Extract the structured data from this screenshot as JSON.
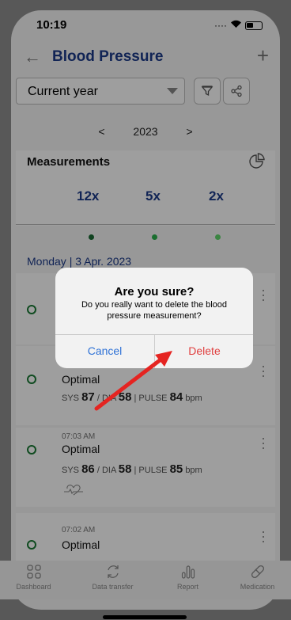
{
  "status": {
    "time": "10:19"
  },
  "header": {
    "title": "Blood Pressure"
  },
  "filter": {
    "selected": "Current year"
  },
  "yearnav": {
    "year": "2023",
    "prev": "<",
    "next": ">"
  },
  "summary": {
    "title": "Measurements",
    "counts": [
      "12x",
      "5x",
      "2x"
    ]
  },
  "list": {
    "day_label": "Monday | 3 Apr. 2023",
    "entries": [
      {
        "time": "",
        "status": "",
        "sys": "",
        "dia": "",
        "pulse": ""
      },
      {
        "time": "",
        "status": "Optimal",
        "sys": "87",
        "dia": "58",
        "pulse": "84"
      },
      {
        "time": "07:03 AM",
        "status": "Optimal",
        "sys": "86",
        "dia": "58",
        "pulse": "85"
      },
      {
        "time": "07:02 AM",
        "status": "Optimal",
        "sys": "",
        "dia": "",
        "pulse": ""
      }
    ],
    "labels": {
      "sys": "SYS",
      "dia": "DIA",
      "pulse": "PULSE",
      "bpm": "bpm",
      "sep": "/",
      "bar": "|"
    }
  },
  "tabs": [
    "Dashboard",
    "Data transfer",
    "Report",
    "Medication"
  ],
  "dialog": {
    "title": "Are you sure?",
    "message": "Do you really want to delete the blood pressure measurement?",
    "cancel": "Cancel",
    "delete": "Delete"
  },
  "colors": {
    "accent": "#1c3a8a",
    "dot1": "#1a6b35",
    "dot2": "#2ab24c",
    "dot3": "#5fd76b",
    "delete": "#e04040",
    "cancel": "#2f72d6",
    "arrow": "#e52421"
  }
}
